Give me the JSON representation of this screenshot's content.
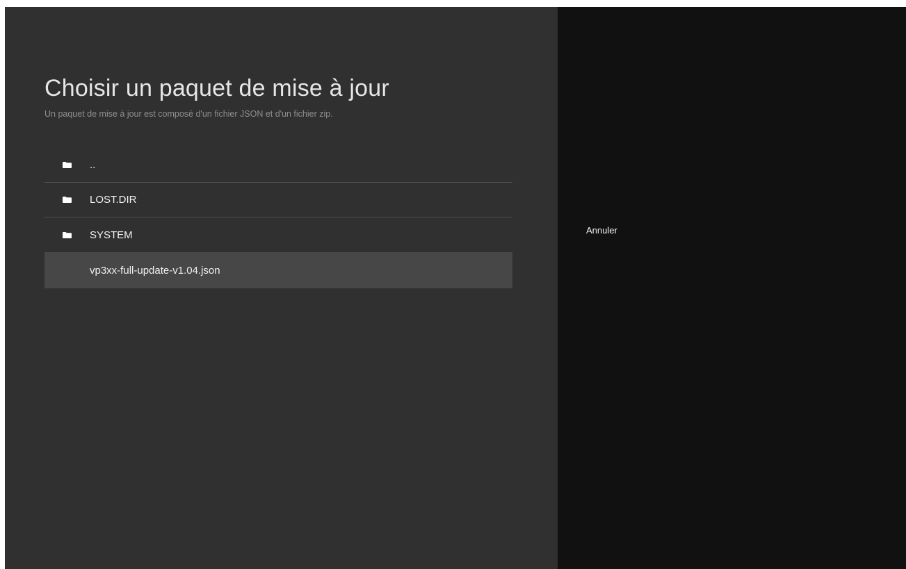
{
  "dialog": {
    "title": "Choisir un paquet de mise à jour",
    "subtitle": "Un paquet de mise à jour est composé d'un fichier JSON et d'un fichier zip."
  },
  "files": [
    {
      "name": "..",
      "icon": "folder-icon",
      "selected": false
    },
    {
      "name": "LOST.DIR",
      "icon": "folder-icon",
      "selected": false
    },
    {
      "name": "SYSTEM",
      "icon": "folder-icon",
      "selected": false
    },
    {
      "name": "vp3xx-full-update-v1.04.json",
      "icon": "",
      "selected": true
    }
  ],
  "actions": {
    "cancel_label": "Annuler"
  },
  "colors": {
    "left_panel_bg": "#303030",
    "right_panel_bg": "#111111",
    "selected_row_bg": "#474747"
  }
}
